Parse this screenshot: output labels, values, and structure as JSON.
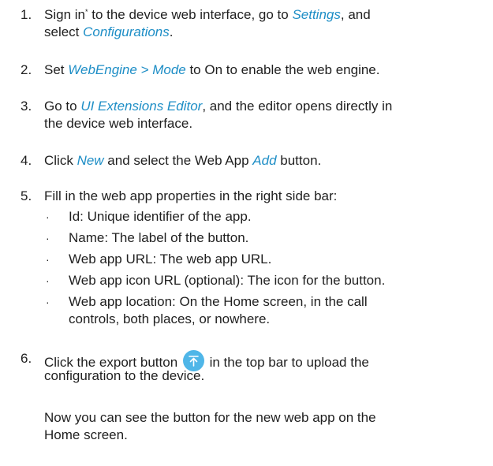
{
  "steps": [
    {
      "number": "1.",
      "parts": {
        "t1": "Sign in",
        "footnote": "*",
        "t2": " to the device web interface, go to ",
        "settings": "Settings",
        "t3": ", and",
        "t4": "select ",
        "configurations": "Configurations",
        "t5": "."
      }
    },
    {
      "number": "2.",
      "parts": {
        "t1": "Set ",
        "path": "WebEngine > Mode",
        "t2": " to ",
        "value": "On",
        "t3": " to enable the web engine."
      }
    },
    {
      "number": "3.",
      "parts": {
        "t1": "Go to ",
        "editor": "UI Extensions Editor",
        "t2": ", and the editor opens directly in",
        "t3": "the device web interface."
      }
    },
    {
      "number": "4.",
      "parts": {
        "t1": "Click ",
        "new": "New",
        "t2": " and select the Web App ",
        "add": "Add",
        "t3": " button."
      }
    },
    {
      "number": "5.",
      "parts": {
        "t1": "Fill in the web app properties in the right side bar:"
      },
      "bullets": [
        {
          "lines": [
            "Id: Unique identifier of the app."
          ]
        },
        {
          "lines": [
            "Name: The label of the button."
          ]
        },
        {
          "lines": [
            "Web app URL: The web app URL."
          ]
        },
        {
          "lines": [
            "Web app icon URL (optional): The icon for the button."
          ]
        },
        {
          "lines": [
            "Web app location: On the Home screen, in the call",
            "controls, both places, or nowhere."
          ]
        }
      ]
    },
    {
      "number": "6.",
      "parts": {
        "t1": "Click the export button ",
        "icon": "upload-icon",
        "t2": " in the top bar to upload the",
        "t3": "configuration to the device."
      },
      "note": {
        "l1": "Now you can see the button for the new web app on the",
        "l2": "Home screen."
      }
    }
  ],
  "bullet_symbol": "·",
  "colors": {
    "text": "#1f1f1f",
    "link": "#1e8ec6",
    "icon_bg": "#4fb6e8"
  }
}
